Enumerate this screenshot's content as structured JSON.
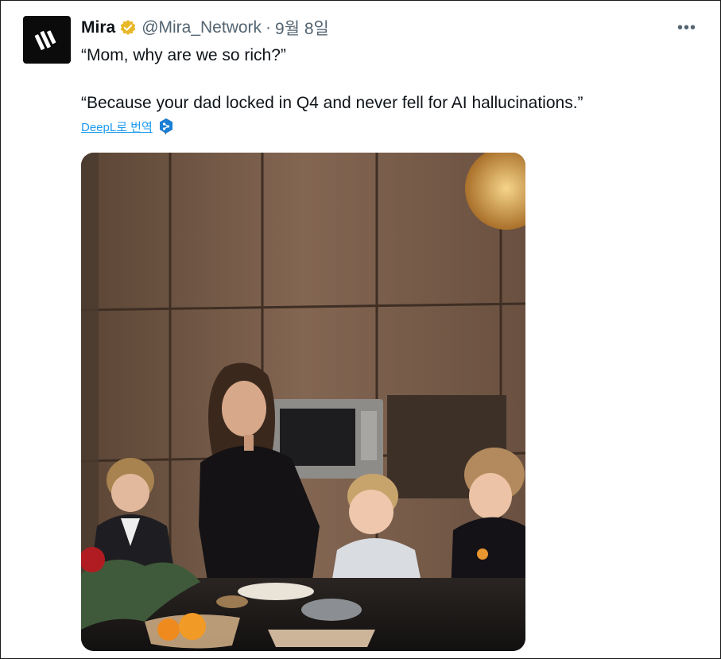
{
  "tweet": {
    "author_name": "Mira",
    "handle": "@Mira_Network",
    "separator": "·",
    "date": "9월 8일",
    "text_line1": "“Mom, why are we so rich?”",
    "text_line2": "“Because your dad locked in Q4 and never fell for AI hallucinations.”",
    "translate_label": "DeepL로 번역",
    "more_label": "•••"
  },
  "icons": {
    "avatar": "mira-logo-icon",
    "verified": "verified-badge-icon",
    "more": "more-options-icon",
    "translate": "deepl-icon"
  },
  "colors": {
    "verified_gold": "#e8b829",
    "link_blue": "#1d9bf0",
    "secondary_text": "#536471",
    "avatar_bg": "#0b0b0b"
  },
  "media": {
    "type": "photo"
  }
}
